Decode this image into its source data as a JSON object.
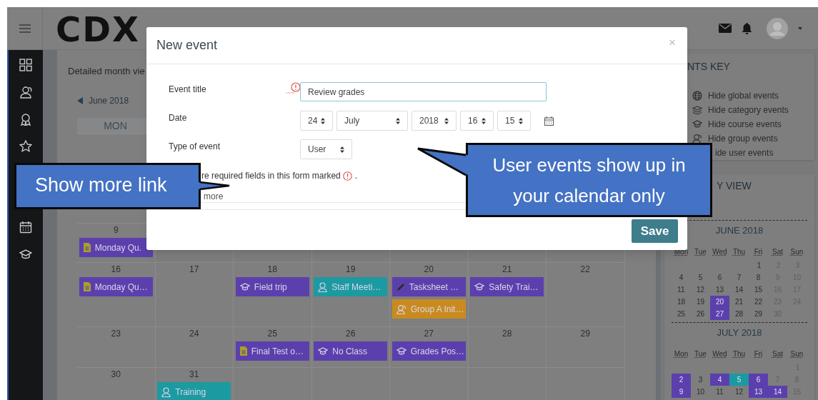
{
  "header": {
    "logo_bold": "CDX"
  },
  "page": {
    "subtitle": "Detailed month vie",
    "prev_month": "June 2018"
  },
  "calendar": {
    "weekday": "MON",
    "weeks": [
      {
        "days": [
          {
            "day": "9",
            "events": [
              {
                "title": "Monday Qu.",
                "kind": "quiz",
                "color": "#5b40ad"
              }
            ]
          }
        ]
      },
      {
        "days": [
          {
            "day": "16",
            "events": [
              {
                "title": "Monday Qu…",
                "kind": "quiz",
                "color": "#5b40ad"
              }
            ]
          },
          {
            "day": "17"
          },
          {
            "day": "18",
            "events": [
              {
                "title": "Field trip",
                "kind": "course",
                "color": "#5b40ad"
              }
            ]
          },
          {
            "day": "19",
            "events": [
              {
                "title": "Staff Meeti…",
                "kind": "user",
                "color": "#1c9aa1"
              }
            ]
          },
          {
            "day": "20",
            "events": [
              {
                "title": "Tasksheet …",
                "kind": "assignment",
                "color": "#5b40ad"
              },
              {
                "title": "Group A Init…",
                "kind": "group",
                "color": "#c98b1f"
              }
            ]
          },
          {
            "day": "21",
            "events": [
              {
                "title": "Safety Trai…",
                "kind": "course",
                "color": "#5b40ad"
              }
            ]
          },
          {
            "day": "22"
          }
        ]
      },
      {
        "days": [
          {
            "day": "23"
          },
          {
            "day": "24"
          },
          {
            "day": "25",
            "events": [
              {
                "title": "Final Test o…",
                "kind": "quiz",
                "color": "#5b40ad"
              }
            ]
          },
          {
            "day": "26",
            "events": [
              {
                "title": "No Class",
                "kind": "course",
                "color": "#5b40ad"
              }
            ]
          },
          {
            "day": "27",
            "events": [
              {
                "title": "Grades Pos…",
                "kind": "course",
                "color": "#5b40ad"
              }
            ]
          },
          {
            "day": "28"
          },
          {
            "day": "29"
          }
        ]
      },
      {
        "days": [
          {
            "day": "30"
          },
          {
            "day": "31",
            "events": [
              {
                "title": "Training",
                "kind": "user",
                "color": "#1c9aa1"
              }
            ]
          }
        ]
      }
    ]
  },
  "events_key": {
    "heading": "NTS KEY",
    "items": [
      {
        "label": "Hide global events",
        "kind": "global"
      },
      {
        "label": "Hide category events",
        "kind": "category"
      },
      {
        "label": "Hide course events",
        "kind": "course"
      },
      {
        "label": "Hide group events",
        "kind": "group"
      },
      {
        "label": "ide user events"
      }
    ]
  },
  "monthly_view": {
    "heading": "Y VIEW",
    "months": [
      {
        "title": "JUNE 2018",
        "weekdays": [
          "Mon",
          "Tue",
          "Wed",
          "Thu",
          "Fri",
          "Sat",
          "Sun"
        ],
        "weeks": [
          [
            "1",
            "2",
            "3"
          ],
          [
            "4",
            "5",
            "6",
            "7",
            "8",
            "9",
            "10"
          ],
          [
            "11",
            "12",
            "13",
            "14",
            "15",
            "16",
            "17"
          ],
          [
            "18",
            "19",
            {
              "d": "20",
              "color": "#5b40ad"
            },
            "21",
            "22",
            "23",
            "24"
          ],
          [
            "25",
            "26",
            {
              "d": "27",
              "color": "#5b40ad"
            },
            "28",
            "29",
            "30"
          ]
        ]
      },
      {
        "title": "JULY 2018",
        "weekdays": [
          "Mon",
          "Tue",
          "Wed",
          "Thu",
          "Fri",
          "Sat",
          "Sun"
        ],
        "weeks": [
          [
            "1"
          ],
          [
            {
              "d": "2",
              "color": "#5b40ad"
            },
            "3",
            {
              "d": "4",
              "color": "#5b40ad"
            },
            {
              "d": "5",
              "color": "#1c9aa1"
            },
            {
              "d": "6",
              "color": "#5b40ad"
            },
            "7",
            "8"
          ],
          [
            {
              "d": "9",
              "color": "#5b40ad"
            },
            "10",
            "11",
            "12",
            {
              "d": "13",
              "color": "#5b40ad"
            },
            {
              "d": "14",
              "color": "#5b40ad"
            },
            "15"
          ]
        ]
      }
    ]
  },
  "modal": {
    "title": "New event",
    "close": "×",
    "fields": [
      {
        "label": "Event title",
        "kind": "text",
        "required": true,
        "value": "Review grades"
      },
      {
        "label": "Date",
        "kind": "date",
        "selects": [
          "24",
          "July",
          "2018",
          "16",
          "15"
        ]
      },
      {
        "label": "Type of event",
        "kind": "select",
        "selects": [
          "User"
        ]
      }
    ],
    "required_note": "re required fields in this form marked",
    "required_note_end": ".",
    "show_more_link": "more",
    "save": "Save"
  },
  "callouts": [
    {
      "text": "Show more link"
    },
    {
      "text": "User events show up in your calendar only"
    }
  ]
}
